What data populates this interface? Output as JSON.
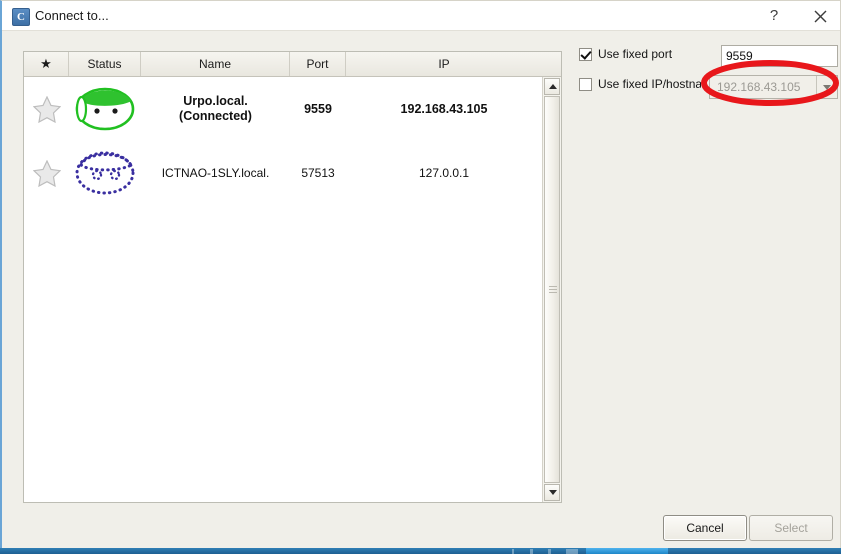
{
  "window": {
    "title": "Connect to...",
    "app_icon": "C",
    "help_button": "?",
    "close_icon": "close-icon"
  },
  "list": {
    "columns": [
      {
        "key": "favorite",
        "label": "★",
        "icon": "star-icon"
      },
      {
        "key": "status",
        "label": "Status"
      },
      {
        "key": "name",
        "label": "Name"
      },
      {
        "key": "port",
        "label": "Port"
      },
      {
        "key": "ip",
        "label": "IP"
      }
    ],
    "rows": [
      {
        "favorite": false,
        "status_icon": "nao-robot-head-icon",
        "status_state": "connected",
        "name_line1": "Urpo.local.",
        "name_line2": "(Connected)",
        "port": "9559",
        "ip": "192.168.43.105",
        "bold": true
      },
      {
        "favorite": false,
        "status_icon": "nao-robot-head-icon",
        "status_state": "discovered",
        "name_line1": "ICTNAO-1SLY.local.",
        "name_line2": "",
        "port": "57513",
        "ip": "127.0.0.1",
        "bold": false
      }
    ]
  },
  "scrollbar": {
    "up_arrow": "triangle-up-icon",
    "down_arrow": "triangle-down-icon"
  },
  "options": {
    "fixed_port": {
      "label": "Use fixed port",
      "checked": true,
      "value": "9559"
    },
    "fixed_ip": {
      "label": "Use fixed IP/hostname",
      "checked": false,
      "value": "192.168.43.105",
      "dropdown_icon": "chevron-down-icon"
    }
  },
  "footer": {
    "cancel_label": "Cancel",
    "select_label": "Select",
    "select_enabled": false
  },
  "annotation": {
    "shape": "ellipse",
    "color": "#e8171b",
    "target": "fixed-ip-combobox"
  },
  "colors": {
    "window_bg": "#f0efe9",
    "titlebar_bg": "#ffffff",
    "list_bg": "#ffffff",
    "header_bg": "#efedE6",
    "connected_icon": "#21c021",
    "discovered_icon": "#3a2fa0",
    "annotation_red": "#e8171b",
    "taskbar_blue": "#1d5f92"
  }
}
